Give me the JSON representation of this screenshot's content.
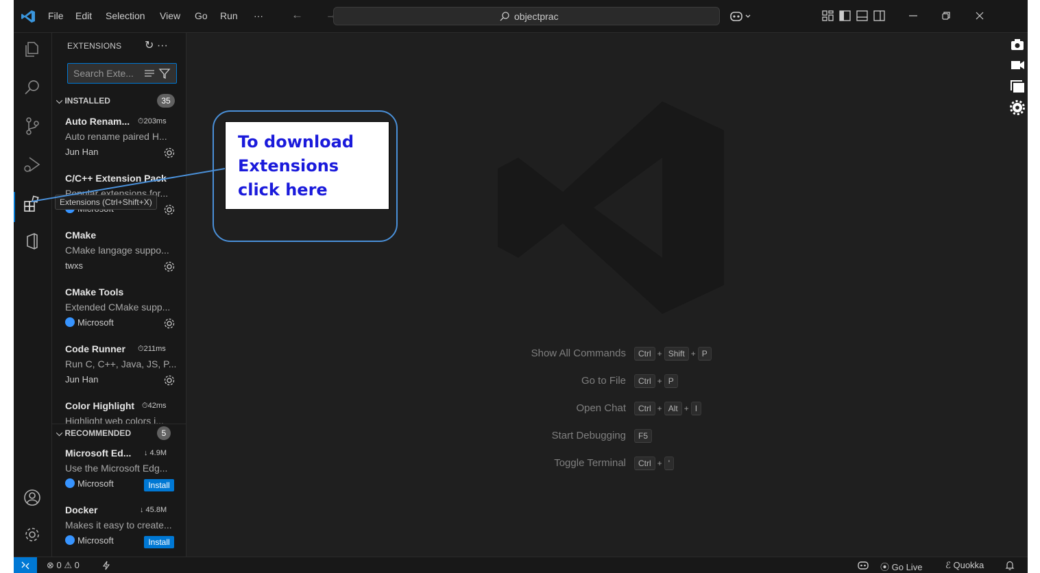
{
  "titlebar": {
    "menu": [
      "File",
      "Edit",
      "Selection",
      "View",
      "Go",
      "Run",
      "···"
    ],
    "nav_arrows": "← →",
    "search_text": "objectprac"
  },
  "sidebar": {
    "title": "EXTENSIONS",
    "title_actions": "↻ ···",
    "search_placeholder": "Search Exte...",
    "installed_label": "INSTALLED",
    "installed_count": "35",
    "recommended_label": "RECOMMENDED",
    "recommended_count": "5",
    "installed": [
      {
        "name": "Auto Renam...",
        "meta": "⏱203ms",
        "desc": "Auto rename paired H...",
        "publisher": "Jun Han",
        "verified": false
      },
      {
        "name": "C/C++ Extension Pack",
        "meta": "",
        "desc": "Popular extensions for...",
        "publisher": "Microsoft",
        "verified": true
      },
      {
        "name": "CMake",
        "meta": "",
        "desc": "CMake langage suppo...",
        "publisher": "twxs",
        "verified": false
      },
      {
        "name": "CMake Tools",
        "meta": "",
        "desc": "Extended CMake supp...",
        "publisher": "Microsoft",
        "verified": true
      },
      {
        "name": "Code Runner",
        "meta": "⏱211ms",
        "desc": "Run C, C++, Java, JS, P...",
        "publisher": "Jun Han",
        "verified": false
      },
      {
        "name": "Color Highlight",
        "meta": "⏱42ms",
        "desc": "Highlight web colors i...",
        "publisher": "",
        "verified": false
      }
    ],
    "recommended": [
      {
        "name": "Microsoft Ed...",
        "meta": "↓ 4.9M",
        "desc": "Use the Microsoft Edg...",
        "publisher": "Microsoft",
        "verified": true,
        "action": "Install"
      },
      {
        "name": "Docker",
        "meta": "↓ 45.8M",
        "desc": "Makes it easy to create...",
        "publisher": "Microsoft",
        "verified": true,
        "action": "Install"
      }
    ]
  },
  "tooltip": "Extensions (Ctrl+Shift+X)",
  "callout": "To download Extensions click here",
  "editor": {
    "commands": [
      {
        "label": "Show All Commands",
        "keys": [
          "Ctrl",
          "Shift",
          "P"
        ]
      },
      {
        "label": "Go to File",
        "keys": [
          "Ctrl",
          "P"
        ]
      },
      {
        "label": "Open Chat",
        "keys": [
          "Ctrl",
          "Alt",
          "I"
        ]
      },
      {
        "label": "Start Debugging",
        "keys": [
          "F5"
        ]
      },
      {
        "label": "Toggle Terminal",
        "keys": [
          "Ctrl",
          "'"
        ]
      }
    ]
  },
  "statusbar": {
    "problems": "⊗ 0 ⚠ 0",
    "go_live": "Go Live",
    "quokka": "Quokka"
  },
  "colors": {
    "accent": "#0078d4",
    "callout_text": "#1a1adb",
    "callout_border": "#4a90d9"
  }
}
